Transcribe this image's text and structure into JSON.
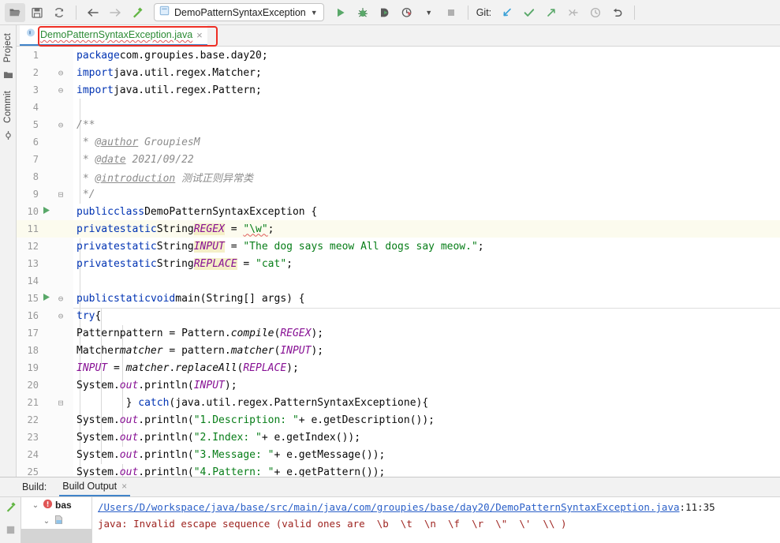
{
  "toolbar": {
    "icons": [
      {
        "name": "open-folder-icon",
        "active": true
      },
      {
        "name": "save-all-icon",
        "active": false
      },
      {
        "name": "sync-icon",
        "active": false
      }
    ],
    "nav_icons": [
      {
        "name": "back-arrow-icon"
      },
      {
        "name": "forward-arrow-icon"
      },
      {
        "name": "build-hammer-icon"
      }
    ],
    "run_config": {
      "label": "DemoPatternSyntaxException",
      "dropdown_glyph": "▼",
      "icon_name": "run-config-class-icon"
    },
    "run_icons": [
      {
        "name": "run-icon"
      },
      {
        "name": "debug-icon"
      },
      {
        "name": "run-with-coverage-icon"
      },
      {
        "name": "profiler-icon"
      },
      {
        "name": "stop-icon"
      }
    ],
    "git": {
      "label": "Git:",
      "icons": [
        {
          "name": "git-update-project-icon"
        },
        {
          "name": "git-commit-icon"
        },
        {
          "name": "git-push-icon"
        },
        {
          "name": "git-merge-icon"
        },
        {
          "name": "git-history-icon"
        },
        {
          "name": "git-rollback-icon"
        }
      ]
    }
  },
  "leftbar": {
    "project_label": "Project",
    "project_icon": "folder-icon",
    "commit_label": "Commit",
    "commit_icon": "commit-node-icon"
  },
  "editor_tabs": {
    "active_tab": "DemoPatternSyntaxException.java",
    "close_glyph": "×",
    "file_icon": "java-class-icon",
    "annotation_color": "#ee2e24"
  },
  "editor": {
    "lines": [
      {
        "n": "1",
        "run": false,
        "fold": "",
        "hl": false
      },
      {
        "n": "2",
        "run": false,
        "fold": "⊖",
        "hl": false
      },
      {
        "n": "3",
        "run": false,
        "fold": "⊖",
        "hl": false
      },
      {
        "n": "4",
        "run": false,
        "fold": "",
        "hl": false
      },
      {
        "n": "5",
        "run": false,
        "fold": "⊖",
        "hl": false
      },
      {
        "n": "6",
        "run": false,
        "fold": "",
        "hl": false
      },
      {
        "n": "7",
        "run": false,
        "fold": "",
        "hl": false
      },
      {
        "n": "8",
        "run": false,
        "fold": "",
        "hl": false
      },
      {
        "n": "9",
        "run": false,
        "fold": "⊟",
        "hl": false
      },
      {
        "n": "10",
        "run": true,
        "fold": "",
        "hl": false
      },
      {
        "n": "11",
        "run": false,
        "fold": "",
        "hl": true
      },
      {
        "n": "12",
        "run": false,
        "fold": "",
        "hl": false
      },
      {
        "n": "13",
        "run": false,
        "fold": "",
        "hl": false
      },
      {
        "n": "14",
        "run": false,
        "fold": "",
        "hl": false
      },
      {
        "n": "15",
        "run": true,
        "fold": "⊖",
        "hl": false
      },
      {
        "n": "16",
        "run": false,
        "fold": "⊖",
        "hl": false
      },
      {
        "n": "17",
        "run": false,
        "fold": "",
        "hl": false
      },
      {
        "n": "18",
        "run": false,
        "fold": "",
        "hl": false
      },
      {
        "n": "19",
        "run": false,
        "fold": "",
        "hl": false
      },
      {
        "n": "20",
        "run": false,
        "fold": "",
        "hl": false
      },
      {
        "n": "21",
        "run": false,
        "fold": "⊟",
        "hl": false
      },
      {
        "n": "22",
        "run": false,
        "fold": "",
        "hl": false
      },
      {
        "n": "23",
        "run": false,
        "fold": "",
        "hl": false
      },
      {
        "n": "24",
        "run": false,
        "fold": "",
        "hl": false
      },
      {
        "n": "25",
        "run": false,
        "fold": "",
        "hl": false
      }
    ],
    "source_text": [
      "package com.groupies.base.day20;",
      "import java.util.regex.Matcher;",
      "import java.util.regex.Pattern;",
      "",
      "/**",
      " * @author GroupiesM",
      " * @date 2021/09/22",
      " * @introduction 测试正则异常类",
      " */",
      "public class DemoPatternSyntaxException {",
      "    private static String REGEX = \"\\w\";",
      "    private static String INPUT = \"The dog says meow All dogs say meow.\";",
      "    private static String REPLACE = \"cat\";",
      "",
      "    public static void main(String[] args) {",
      "        try{",
      "            Pattern pattern = Pattern.compile(REGEX);",
      "            Matcher matcher = pattern.matcher(INPUT);",
      "            INPUT = matcher.replaceAll(REPLACE);",
      "            System.out.println(INPUT);",
      "        } catch(java.util.regex.PatternSyntaxException e){",
      "            System.out.println(\"1.Description: \"+ e.getDescription());",
      "            System.out.println(\"2.Index: \"+ e.getIndex());",
      "            System.out.println(\"3.Message: \"+ e.getMessage());",
      "            System.out.println(\"4.Pattern: \"+ e.getPattern());"
    ]
  },
  "build_panel": {
    "title": "Build:",
    "tab_label": "Build Output",
    "tab_close_glyph": "×",
    "side_icons": [
      {
        "name": "build-hammer-icon"
      },
      {
        "name": "stop-icon"
      }
    ],
    "tree": [
      {
        "chev": "⌄",
        "icon": "error-icon",
        "label": "bas",
        "selected": false
      },
      {
        "chev": "⌄",
        "icon": "java-file-icon",
        "label": "",
        "selected": false
      },
      {
        "chev": "",
        "icon": "",
        "label": "",
        "selected": true
      }
    ],
    "output": {
      "file_link": "/Users/D/workspace/java/base/src/main/java/com/groupies/base/day20/DemoPatternSyntaxException.java",
      "position": ":11:35",
      "error_message": "java: Invalid escape sequence (valid ones are  \\b  \\t  \\n  \\f  \\r  \\\"  \\'  \\\\ )"
    }
  },
  "colors": {
    "keyword": "#0033b3",
    "string": "#067d17",
    "field": "#871094",
    "comment": "#8c8c8c",
    "error": "#9e2420",
    "link": "#2b60c8",
    "accent": "#4083c9",
    "annotation": "#ee2e24",
    "tab_text_green": "#2a8a33"
  }
}
